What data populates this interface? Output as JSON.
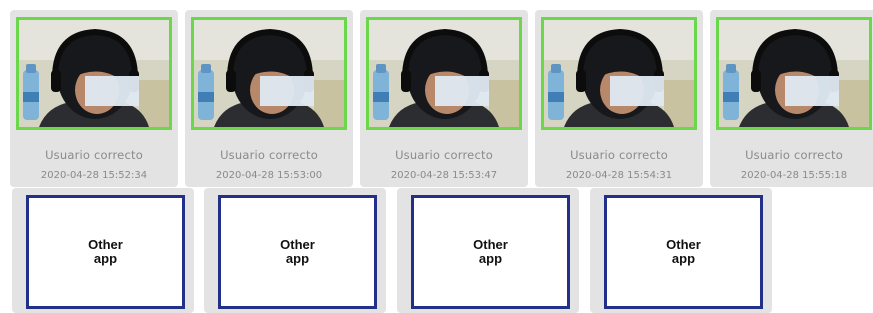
{
  "captures": [
    {
      "status": "Usuario correcto",
      "timestamp": "2020-04-28 15:52:34"
    },
    {
      "status": "Usuario correcto",
      "timestamp": "2020-04-28 15:53:00"
    },
    {
      "status": "Usuario correcto",
      "timestamp": "2020-04-28 15:53:47"
    },
    {
      "status": "Usuario correcto",
      "timestamp": "2020-04-28 15:54:31"
    },
    {
      "status": "Usuario correcto",
      "timestamp": "2020-04-28 15:55:18"
    }
  ],
  "apps": [
    {
      "line1": "Other",
      "line2": "app"
    },
    {
      "line1": "Other",
      "line2": "app"
    },
    {
      "line1": "Other",
      "line2": "app"
    },
    {
      "line1": "Other",
      "line2": "app"
    }
  ],
  "colors": {
    "verified_border": "#6ad84a",
    "app_border": "#23308a",
    "card_background": "#e3e3e3",
    "meta_text": "#8a8a8a"
  }
}
